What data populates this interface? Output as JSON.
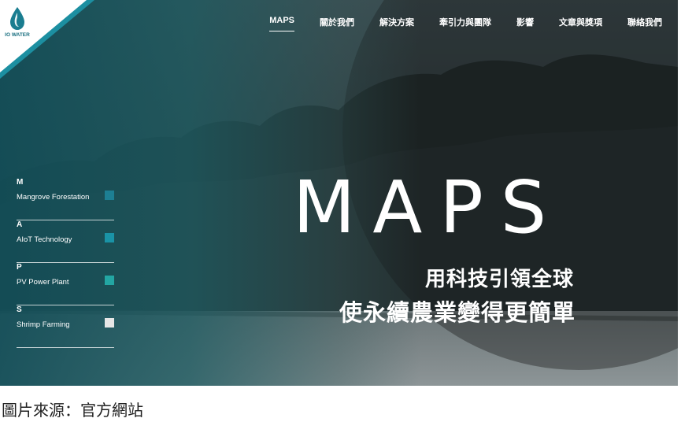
{
  "brand": {
    "logo_text": "IO WATER"
  },
  "nav": {
    "items": [
      {
        "label": "MAPS",
        "active": true
      },
      {
        "label": "關於我們"
      },
      {
        "label": "解決方案"
      },
      {
        "label": "牽引力與團隊"
      },
      {
        "label": "影響"
      },
      {
        "label": "文章與獎項"
      },
      {
        "label": "聯絡我們"
      }
    ]
  },
  "sidebar": {
    "items": [
      {
        "letter": "M",
        "label": "Mangrove Forestation",
        "color": "#1d7f93"
      },
      {
        "letter": "A",
        "label": "AIoT Technology",
        "color": "#1a93a6"
      },
      {
        "letter": "P",
        "label": "PV Power Plant",
        "color": "#23a6a3"
      },
      {
        "letter": "S",
        "label": "Shrimp Farming",
        "color": "#e6e6e6"
      }
    ]
  },
  "hero": {
    "title": "MAPS",
    "line1": "用科技引領全球",
    "line2": "使永續農業變得更簡單"
  },
  "caption": "圖片來源：官方網站"
}
